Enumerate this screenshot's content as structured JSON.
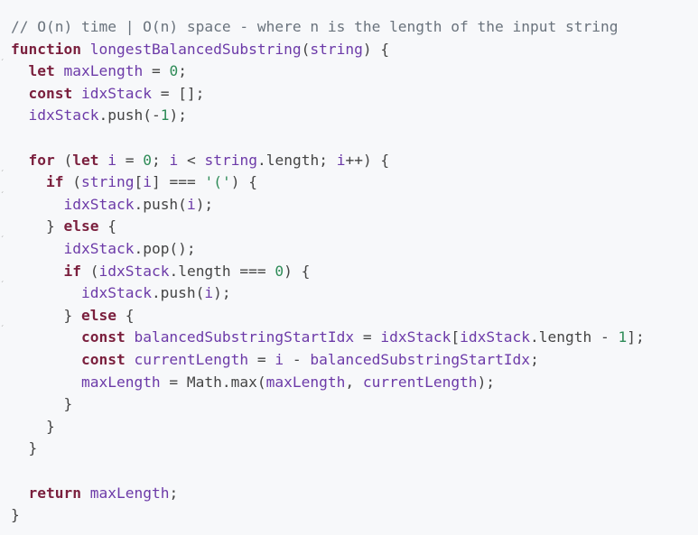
{
  "code": {
    "lines": [
      {
        "fold": false,
        "tokens": [
          {
            "t": "// O(n) time | O(n) space - where n is the length of the input string",
            "c": "cm"
          }
        ]
      },
      {
        "fold": true,
        "tokens": [
          {
            "t": "function",
            "c": "kw"
          },
          {
            "t": " ",
            "c": "pl"
          },
          {
            "t": "longestBalancedSubstring",
            "c": "fn"
          },
          {
            "t": "(",
            "c": "pl"
          },
          {
            "t": "string",
            "c": "var"
          },
          {
            "t": ") {",
            "c": "pl"
          }
        ]
      },
      {
        "fold": false,
        "tokens": [
          {
            "t": "  ",
            "c": "pl"
          },
          {
            "t": "let",
            "c": "kw"
          },
          {
            "t": " ",
            "c": "pl"
          },
          {
            "t": "maxLength",
            "c": "var"
          },
          {
            "t": " = ",
            "c": "pl"
          },
          {
            "t": "0",
            "c": "num"
          },
          {
            "t": ";",
            "c": "pl"
          }
        ]
      },
      {
        "fold": false,
        "tokens": [
          {
            "t": "  ",
            "c": "pl"
          },
          {
            "t": "const",
            "c": "kw"
          },
          {
            "t": " ",
            "c": "pl"
          },
          {
            "t": "idxStack",
            "c": "var"
          },
          {
            "t": " = [];",
            "c": "pl"
          }
        ]
      },
      {
        "fold": false,
        "tokens": [
          {
            "t": "  ",
            "c": "pl"
          },
          {
            "t": "idxStack",
            "c": "var"
          },
          {
            "t": ".push(-",
            "c": "pl"
          },
          {
            "t": "1",
            "c": "num"
          },
          {
            "t": ");",
            "c": "pl"
          }
        ]
      },
      {
        "fold": false,
        "tokens": [
          {
            "t": "",
            "c": "pl"
          }
        ]
      },
      {
        "fold": true,
        "tokens": [
          {
            "t": "  ",
            "c": "pl"
          },
          {
            "t": "for",
            "c": "kw"
          },
          {
            "t": " (",
            "c": "pl"
          },
          {
            "t": "let",
            "c": "kw"
          },
          {
            "t": " ",
            "c": "pl"
          },
          {
            "t": "i",
            "c": "var"
          },
          {
            "t": " = ",
            "c": "pl"
          },
          {
            "t": "0",
            "c": "num"
          },
          {
            "t": "; ",
            "c": "pl"
          },
          {
            "t": "i",
            "c": "var"
          },
          {
            "t": " < ",
            "c": "pl"
          },
          {
            "t": "string",
            "c": "var"
          },
          {
            "t": ".length; ",
            "c": "pl"
          },
          {
            "t": "i",
            "c": "var"
          },
          {
            "t": "++) {",
            "c": "pl"
          }
        ]
      },
      {
        "fold": true,
        "tokens": [
          {
            "t": "    ",
            "c": "pl"
          },
          {
            "t": "if",
            "c": "kw"
          },
          {
            "t": " (",
            "c": "pl"
          },
          {
            "t": "string",
            "c": "var"
          },
          {
            "t": "[",
            "c": "pl"
          },
          {
            "t": "i",
            "c": "var"
          },
          {
            "t": "] === ",
            "c": "pl"
          },
          {
            "t": "'('",
            "c": "str"
          },
          {
            "t": ") {",
            "c": "pl"
          }
        ]
      },
      {
        "fold": false,
        "tokens": [
          {
            "t": "      ",
            "c": "pl"
          },
          {
            "t": "idxStack",
            "c": "var"
          },
          {
            "t": ".push(",
            "c": "pl"
          },
          {
            "t": "i",
            "c": "var"
          },
          {
            "t": ");",
            "c": "pl"
          }
        ]
      },
      {
        "fold": true,
        "tokens": [
          {
            "t": "    } ",
            "c": "pl"
          },
          {
            "t": "else",
            "c": "kw"
          },
          {
            "t": " {",
            "c": "pl"
          }
        ]
      },
      {
        "fold": false,
        "tokens": [
          {
            "t": "      ",
            "c": "pl"
          },
          {
            "t": "idxStack",
            "c": "var"
          },
          {
            "t": ".pop();",
            "c": "pl"
          }
        ]
      },
      {
        "fold": true,
        "tokens": [
          {
            "t": "      ",
            "c": "pl"
          },
          {
            "t": "if",
            "c": "kw"
          },
          {
            "t": " (",
            "c": "pl"
          },
          {
            "t": "idxStack",
            "c": "var"
          },
          {
            "t": ".length === ",
            "c": "pl"
          },
          {
            "t": "0",
            "c": "num"
          },
          {
            "t": ") {",
            "c": "pl"
          }
        ]
      },
      {
        "fold": false,
        "tokens": [
          {
            "t": "        ",
            "c": "pl"
          },
          {
            "t": "idxStack",
            "c": "var"
          },
          {
            "t": ".push(",
            "c": "pl"
          },
          {
            "t": "i",
            "c": "var"
          },
          {
            "t": ");",
            "c": "pl"
          }
        ]
      },
      {
        "fold": true,
        "tokens": [
          {
            "t": "      } ",
            "c": "pl"
          },
          {
            "t": "else",
            "c": "kw"
          },
          {
            "t": " {",
            "c": "pl"
          }
        ]
      },
      {
        "fold": false,
        "tokens": [
          {
            "t": "        ",
            "c": "pl"
          },
          {
            "t": "const",
            "c": "kw"
          },
          {
            "t": " ",
            "c": "pl"
          },
          {
            "t": "balancedSubstringStartIdx",
            "c": "var"
          },
          {
            "t": " = ",
            "c": "pl"
          },
          {
            "t": "idxStack",
            "c": "var"
          },
          {
            "t": "[",
            "c": "pl"
          },
          {
            "t": "idxStack",
            "c": "var"
          },
          {
            "t": ".length - ",
            "c": "pl"
          },
          {
            "t": "1",
            "c": "num"
          },
          {
            "t": "];",
            "c": "pl"
          }
        ]
      },
      {
        "fold": false,
        "tokens": [
          {
            "t": "        ",
            "c": "pl"
          },
          {
            "t": "const",
            "c": "kw"
          },
          {
            "t": " ",
            "c": "pl"
          },
          {
            "t": "currentLength",
            "c": "var"
          },
          {
            "t": " = ",
            "c": "pl"
          },
          {
            "t": "i",
            "c": "var"
          },
          {
            "t": " - ",
            "c": "pl"
          },
          {
            "t": "balancedSubstringStartIdx",
            "c": "var"
          },
          {
            "t": ";",
            "c": "pl"
          }
        ]
      },
      {
        "fold": false,
        "tokens": [
          {
            "t": "        ",
            "c": "pl"
          },
          {
            "t": "maxLength",
            "c": "var"
          },
          {
            "t": " = Math.max(",
            "c": "pl"
          },
          {
            "t": "maxLength",
            "c": "var"
          },
          {
            "t": ", ",
            "c": "pl"
          },
          {
            "t": "currentLength",
            "c": "var"
          },
          {
            "t": ");",
            "c": "pl"
          }
        ]
      },
      {
        "fold": false,
        "tokens": [
          {
            "t": "      }",
            "c": "pl"
          }
        ]
      },
      {
        "fold": false,
        "tokens": [
          {
            "t": "    }",
            "c": "pl"
          }
        ]
      },
      {
        "fold": false,
        "tokens": [
          {
            "t": "  }",
            "c": "pl"
          }
        ]
      },
      {
        "fold": false,
        "tokens": [
          {
            "t": "",
            "c": "pl"
          }
        ]
      },
      {
        "fold": false,
        "tokens": [
          {
            "t": "  ",
            "c": "pl"
          },
          {
            "t": "return",
            "c": "kw"
          },
          {
            "t": " ",
            "c": "pl"
          },
          {
            "t": "maxLength",
            "c": "var"
          },
          {
            "t": ";",
            "c": "pl"
          }
        ]
      },
      {
        "fold": false,
        "tokens": [
          {
            "t": "}",
            "c": "pl"
          }
        ]
      }
    ]
  },
  "colors": {
    "background": "#f7f8fa",
    "keyword": "#7a1f3d",
    "identifier": "#6c3aa8",
    "number": "#2e8b57",
    "comment": "#6a737d",
    "plain": "#444444"
  },
  "icons": {
    "fold_marker": "fold-chevron-icon"
  }
}
